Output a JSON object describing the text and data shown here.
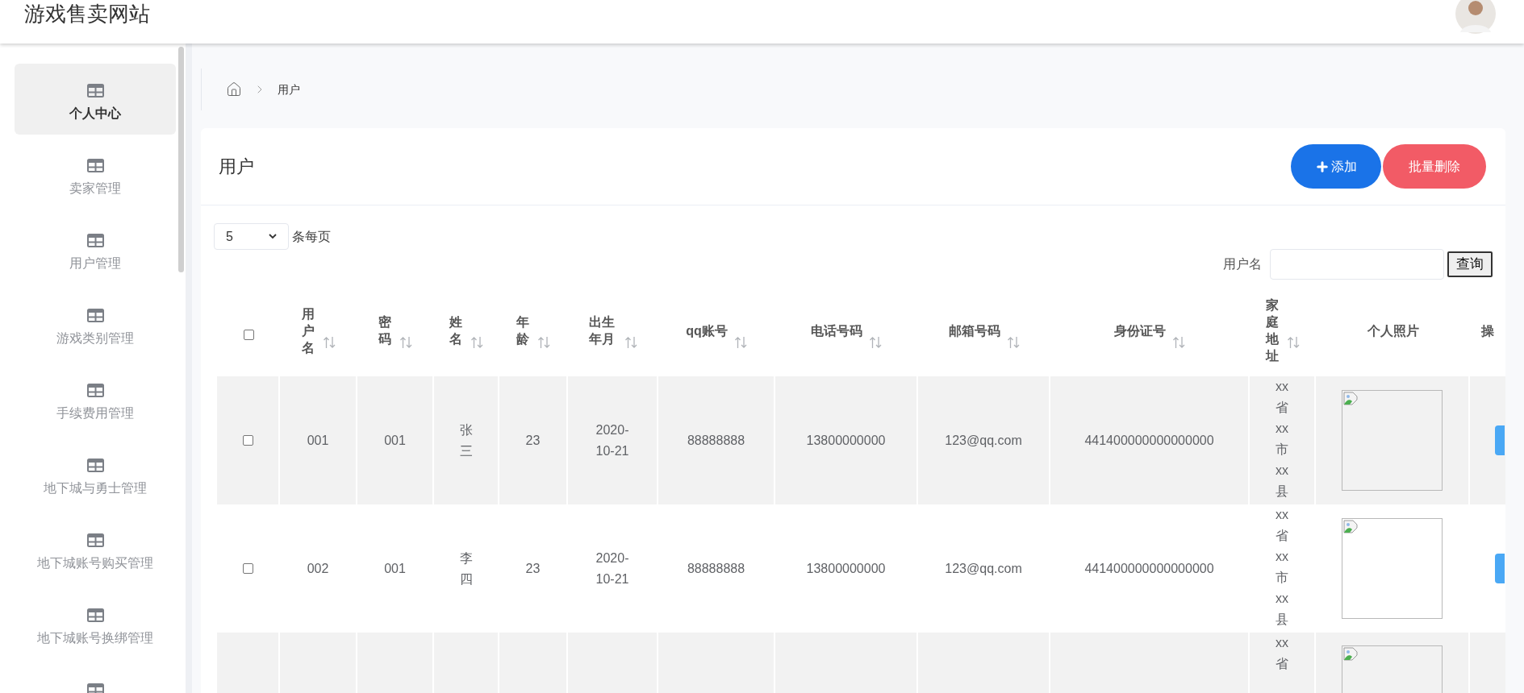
{
  "header": {
    "title": "游戏售卖网站"
  },
  "sidebar": {
    "items": [
      {
        "label": "个人中心",
        "selected": true
      },
      {
        "label": "卖家管理",
        "selected": false
      },
      {
        "label": "用户管理",
        "selected": false
      },
      {
        "label": "游戏类别管理",
        "selected": false
      },
      {
        "label": "手续费用管理",
        "selected": false
      },
      {
        "label": "地下城与勇士管理",
        "selected": false
      },
      {
        "label": "地下城账号购买管理",
        "selected": false
      },
      {
        "label": "地下城账号换绑管理",
        "selected": false
      },
      {
        "selected": false
      }
    ]
  },
  "breadcrumb": [
    "用户"
  ],
  "card": {
    "title": "用户",
    "buttons": [
      {
        "kind": "add",
        "label": "添加"
      },
      {
        "kind": "delete",
        "label": "批量删除"
      }
    ]
  },
  "page_size": {
    "value": "5",
    "suffix": "条每页"
  },
  "search": {
    "label": "用户名",
    "button": "查询"
  },
  "table": {
    "select_all": {
      "checked": false
    },
    "columns": [
      {
        "label": "用户名",
        "sortable": true
      },
      {
        "label": "密码",
        "sortable": true
      },
      {
        "label": "姓名",
        "sortable": true
      },
      {
        "label": "年龄",
        "sortable": true
      },
      {
        "label": "出生年月",
        "sortable": true
      },
      {
        "label": "qq账号",
        "sortable": true
      },
      {
        "label": "电话号码",
        "sortable": true
      },
      {
        "label": "邮箱号码",
        "sortable": true
      },
      {
        "label": "身份证号",
        "sortable": true
      },
      {
        "label": "家庭地址",
        "sortable": true
      },
      {
        "label": "个人照片",
        "sortable": false
      },
      {
        "label": "操",
        "sortable": false
      }
    ],
    "rows": [
      {
        "checked": false,
        "cells": [
          "001",
          "001",
          "张三",
          "23",
          "2020-10-21",
          "88888888",
          "13800000000",
          "123@qq.com",
          "441400000000000000",
          "xx省xx市xx县"
        ]
      },
      {
        "checked": false,
        "cells": [
          "002",
          "001",
          "李四",
          "23",
          "2020-10-21",
          "88888888",
          "13800000000",
          "123@qq.com",
          "441400000000000000",
          "xx省xx市xx县"
        ]
      },
      {
        "cells": [
          null,
          null,
          null,
          null,
          null,
          null,
          null,
          null,
          null,
          "xx省"
        ]
      }
    ]
  }
}
